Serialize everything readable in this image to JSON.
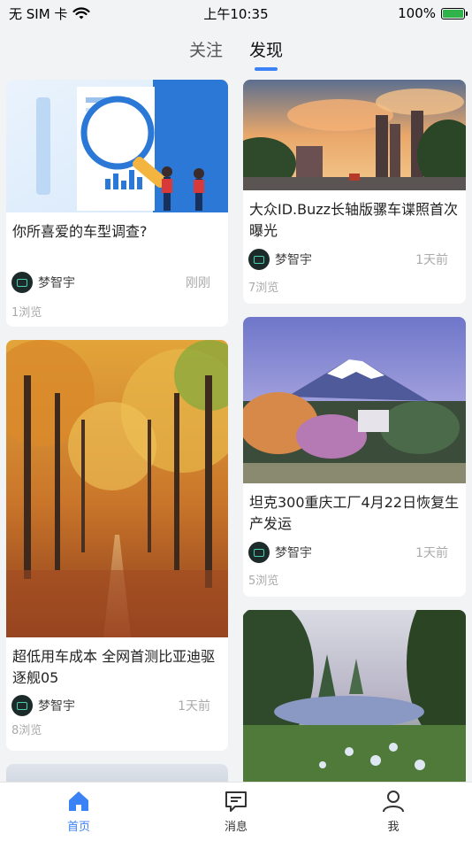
{
  "status": {
    "carrier": "无 SIM 卡",
    "time": "上午10:35",
    "battery": "100%",
    "battery_level": 1.0,
    "icons": [
      "wifi-icon",
      "battery-charging-icon"
    ]
  },
  "tabs": [
    {
      "label": "关注",
      "active": false
    },
    {
      "label": "发现",
      "active": true
    }
  ],
  "accent": "#3b82f6",
  "cards": [
    {
      "title": "你所喜爱的车型调查?",
      "author": "梦智宇",
      "time": "刚刚",
      "views": "1浏览"
    },
    {
      "title": "大众ID.Buzz长轴版骡车谍照首次曝光",
      "author": "梦智宇",
      "time": "1天前",
      "views": "7浏览"
    },
    {
      "title": "坦克300重庆工厂4月22日恢复生产发运",
      "author": "梦智宇",
      "time": "1天前",
      "views": "5浏览"
    },
    {
      "title": "超低用车成本 全网首测比亚迪驱逐舰05",
      "author": "梦智宇",
      "time": "1天前",
      "views": "8浏览"
    }
  ],
  "nav": [
    {
      "label": "首页",
      "icon": "home-icon",
      "active": true
    },
    {
      "label": "消息",
      "icon": "message-icon",
      "active": false
    },
    {
      "label": "我",
      "icon": "person-icon",
      "active": false
    }
  ]
}
